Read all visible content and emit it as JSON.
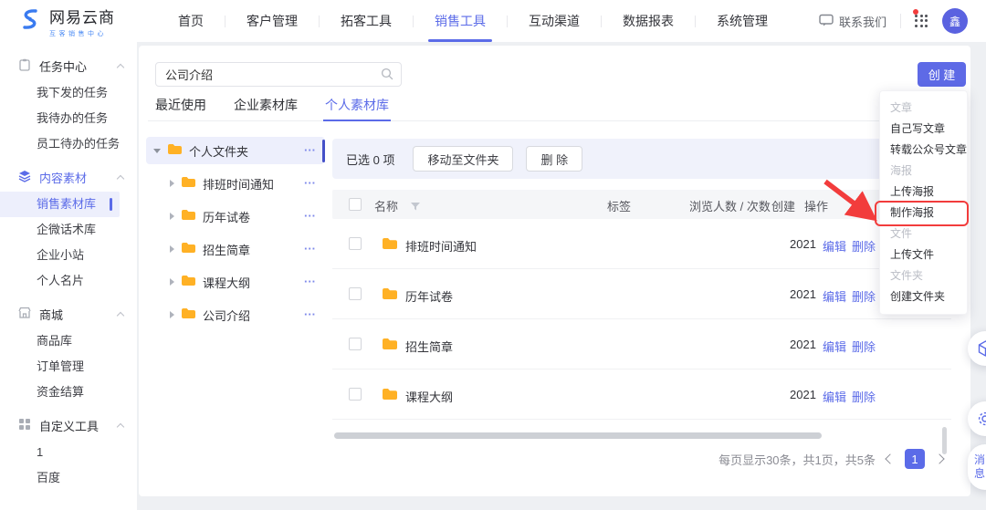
{
  "navbar": {
    "logo_title": "网易云商",
    "logo_subtitle": "互客销售中心",
    "items": [
      {
        "label": "首页"
      },
      {
        "label": "客户管理"
      },
      {
        "label": "拓客工具"
      },
      {
        "label": "销售工具"
      },
      {
        "label": "互动渠道"
      },
      {
        "label": "数据报表"
      },
      {
        "label": "系统管理"
      }
    ],
    "active_item": "销售工具",
    "contact_label": "联系我们",
    "avatar_text": "鑫"
  },
  "sidebar": {
    "sections": [
      {
        "label": "任务中心",
        "icon": "clipboard-icon",
        "items": [
          {
            "label": "我下发的任务"
          },
          {
            "label": "我待办的任务"
          },
          {
            "label": "员工待办的任务"
          }
        ]
      },
      {
        "label": "内容素材",
        "icon": "layers-icon",
        "items": [
          {
            "label": "销售素材库",
            "active": true
          },
          {
            "label": "企微话术库"
          },
          {
            "label": "企业小站"
          },
          {
            "label": "个人名片"
          }
        ]
      },
      {
        "label": "商城",
        "icon": "store-icon",
        "items": [
          {
            "label": "商品库"
          },
          {
            "label": "订单管理"
          },
          {
            "label": "资金结算"
          }
        ]
      },
      {
        "label": "自定义工具",
        "icon": "grid-icon",
        "items": [
          {
            "label": "1"
          },
          {
            "label": "百度"
          }
        ]
      }
    ]
  },
  "content": {
    "search_value": "公司介绍",
    "create_button": "创 建",
    "tabs": [
      {
        "label": "最近使用"
      },
      {
        "label": "企业素材库"
      },
      {
        "label": "个人素材库",
        "active": true
      }
    ],
    "tree": {
      "root": "个人文件夹",
      "children": [
        {
          "label": "排班时间通知"
        },
        {
          "label": "历年试卷"
        },
        {
          "label": "招生简章"
        },
        {
          "label": "课程大纲"
        },
        {
          "label": "公司介绍"
        }
      ]
    },
    "toolbar": {
      "selected_text": "已选 0 项",
      "move_button": "移动至文件夹",
      "delete_button": "删 除"
    },
    "table": {
      "headers": {
        "name": "名称",
        "tag": "标签",
        "views": "浏览人数 / 次数",
        "created": "创建",
        "actions": "操作"
      },
      "rows": [
        {
          "name": "排班时间通知",
          "created": "2021",
          "edit": "编辑",
          "delete": "删除"
        },
        {
          "name": "历年试卷",
          "created": "2021",
          "edit": "编辑",
          "delete": "删除"
        },
        {
          "name": "招生简章",
          "created": "2021",
          "edit": "编辑",
          "delete": "删除"
        },
        {
          "name": "课程大纲",
          "created": "2021",
          "edit": "编辑",
          "delete": "删除"
        }
      ]
    },
    "pagination": {
      "summary": "每页显示30条，共1页，共5条",
      "page": "1"
    }
  },
  "create_menu": {
    "items": [
      {
        "label": "文章",
        "group": true
      },
      {
        "label": "自己写文章"
      },
      {
        "label": "转载公众号文章"
      },
      {
        "label": "海报",
        "group": true
      },
      {
        "label": "上传海报"
      },
      {
        "label": "制作海报",
        "highlighted": true
      },
      {
        "label": "文件",
        "group": true
      },
      {
        "label": "上传文件"
      },
      {
        "label": "文件夹",
        "group": true
      },
      {
        "label": "创建文件夹"
      }
    ]
  },
  "floating": {
    "message_label": "消息"
  },
  "colors": {
    "primary": "#5B6BE8",
    "annotation_red": "#F23C3C",
    "folder_orange": "#FFB125"
  }
}
